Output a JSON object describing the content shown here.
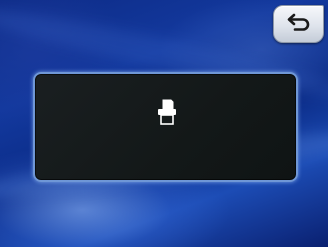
{
  "screen": {
    "background": "blue-swirl-wallpaper"
  },
  "back_button": {
    "icon": "return-arrow-icon",
    "colors": {
      "face": "#e6eaf0",
      "glyph": "#1a1a1a"
    }
  },
  "dialog": {
    "icon": "printer-icon",
    "colors": {
      "panel": "#151a1b",
      "border": "#6f97d6",
      "icon": "#ffffff"
    }
  }
}
